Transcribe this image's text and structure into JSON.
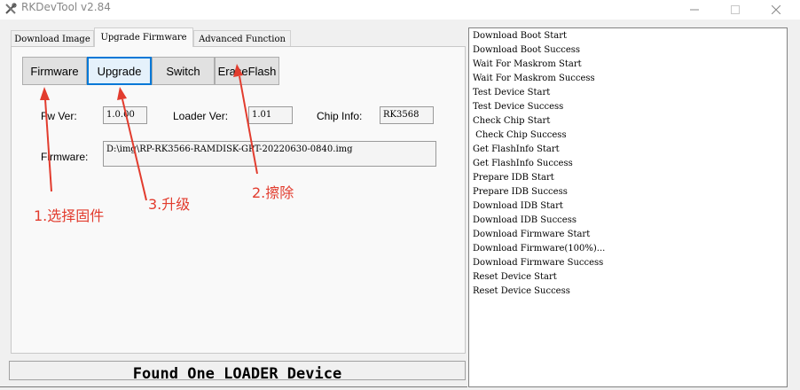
{
  "window": {
    "title": "RKDevTool v2.84"
  },
  "tabs": [
    {
      "label": "Download Image"
    },
    {
      "label": "Upgrade Firmware"
    },
    {
      "label": "Advanced Function"
    }
  ],
  "buttons": {
    "firmware": "Firmware",
    "upgrade": "Upgrade",
    "switch": "Switch",
    "erase_flash": "EraseFlash"
  },
  "fields": {
    "fw_ver_label": "Fw Ver:",
    "fw_ver_value": "1.0.00",
    "loader_ver_label": "Loader Ver:",
    "loader_ver_value": "1.01",
    "chip_info_label": "Chip Info:",
    "chip_info_value": "RK3568",
    "firmware_label": "Firmware:",
    "firmware_value": "D:\\img\\RP-RK3566-RAMDISK-GPT-20220630-0840.img"
  },
  "annotations": {
    "step1": "1.选择固件",
    "step2": "2.擦除",
    "step3": "3.升级"
  },
  "status": "Found One LOADER Device",
  "log": [
    "Download Boot Start",
    "Download Boot Success",
    "Wait For Maskrom Start",
    "Wait For Maskrom Success",
    "Test Device Start",
    "Test Device Success",
    "Check Chip Start",
    " Check Chip Success",
    "Get FlashInfo Start",
    "Get FlashInfo Success",
    "Prepare IDB Start",
    "Prepare IDB Success",
    "Download IDB Start",
    "Download IDB Success",
    "Download Firmware Start",
    "Download Firmware(100%)...",
    "Download Firmware Success",
    "Reset Device Start",
    "Reset Device Success"
  ],
  "colors": {
    "annotation": "#e23c2e",
    "focus_border": "#0078d7"
  }
}
